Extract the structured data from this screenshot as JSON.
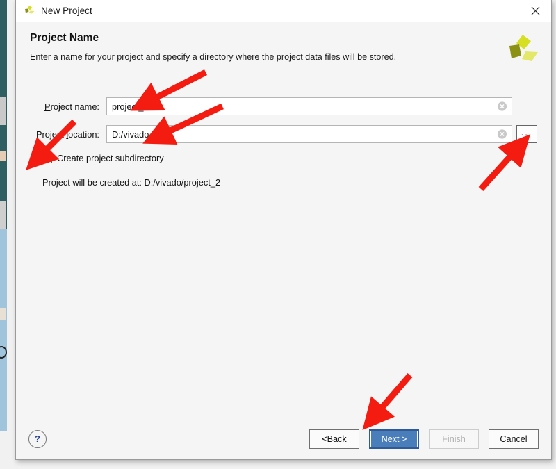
{
  "window": {
    "title": "New Project",
    "app_icon": "vivado-logo-icon",
    "close_icon": "close-icon"
  },
  "header": {
    "page_title": "Project Name",
    "description": "Enter a name for your project and specify a directory where the project data files will be stored.",
    "brand_logo": "vivado-logo-icon",
    "brand_colors": {
      "light": "#d7df23",
      "mid": "#c2cb1e",
      "dark": "#8a9113"
    }
  },
  "form": {
    "project_name": {
      "label": "Project name:",
      "accelerator": "P",
      "value": "project_2",
      "clear_icon": "clear-circle-icon"
    },
    "project_location": {
      "label": "Project location:",
      "accelerator": "l",
      "value": "D:/vivado",
      "clear_icon": "clear-circle-icon",
      "browse_label": "...",
      "browse_icon": "ellipsis-icon"
    },
    "create_subdirectory": {
      "label": "Create project subdirectory",
      "checked": true,
      "check_icon": "check-mark-icon"
    },
    "created_at_text": "Project will be created at: D:/vivado/project_2"
  },
  "footer": {
    "help_label": "?",
    "help_icon": "question-mark-icon",
    "buttons": [
      {
        "id": "back",
        "label": "< Back",
        "accelerator": "B",
        "state": "enabled"
      },
      {
        "id": "next",
        "label": "Next >",
        "accelerator": "N",
        "state": "focused"
      },
      {
        "id": "finish",
        "label": "Finish",
        "accelerator": "F",
        "state": "disabled"
      },
      {
        "id": "cancel",
        "label": "Cancel",
        "accelerator": "",
        "state": "enabled"
      }
    ]
  },
  "annotations": {
    "color": "#f41b10",
    "arrows": [
      {
        "name": "arrow-to-project-name-field",
        "points_at": "project name input"
      },
      {
        "name": "arrow-to-project-location-field",
        "points_at": "project location input"
      },
      {
        "name": "arrow-to-create-subdirectory",
        "points_at": "create project subdirectory checkbox"
      },
      {
        "name": "arrow-to-browse-button",
        "points_at": "browse ... button"
      },
      {
        "name": "arrow-to-next-button",
        "points_at": "Next > button"
      }
    ]
  }
}
